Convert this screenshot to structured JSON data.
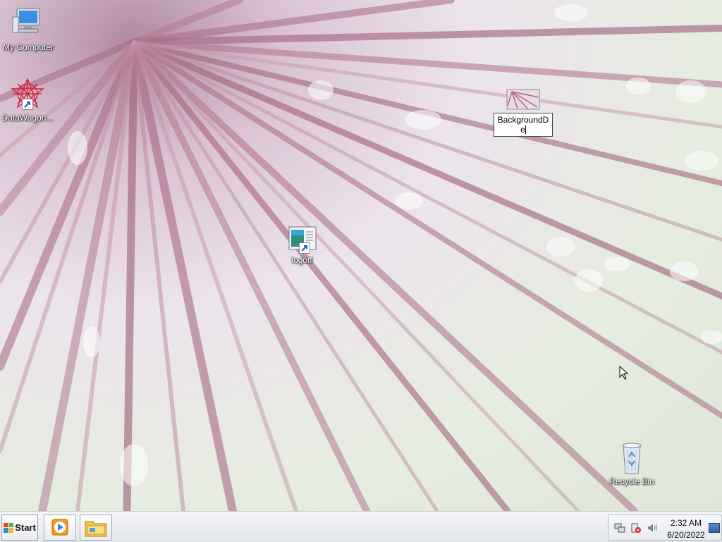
{
  "desktop": {
    "icons": [
      {
        "label": "My Computer"
      },
      {
        "label": "DataWagon..."
      },
      {
        "label": "BackgroundD e",
        "renaming": true
      },
      {
        "label": "logoff"
      },
      {
        "label": "Recycle Bin"
      }
    ]
  },
  "taskbar": {
    "start_label": "Start",
    "pinned": [
      "media-player-icon",
      "explorer-folder-icon"
    ],
    "tray_icons": [
      "network-icon",
      "action-center-icon",
      "volume-icon"
    ]
  },
  "clock": {
    "time": "2:32 AM",
    "date": "6/20/2022"
  },
  "colors": {
    "accent_windows_red": "#e8412a",
    "accent_windows_green": "#5db13a",
    "accent_windows_blue": "#2e86d8",
    "accent_windows_yellow": "#f2b91c"
  }
}
